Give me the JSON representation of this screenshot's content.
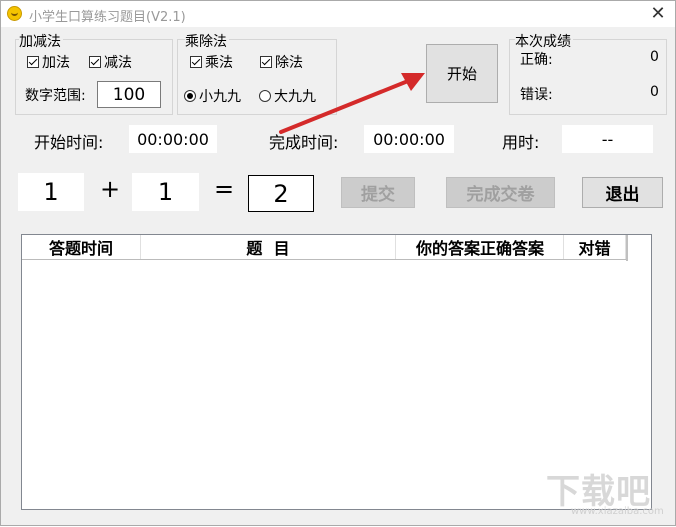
{
  "window": {
    "title": "小学生口算练习题目(V2.1)",
    "close_label": "✕"
  },
  "add_sub": {
    "title": "加减法",
    "add_label": "加法",
    "add_checked": true,
    "sub_label": "减法",
    "sub_checked": true,
    "range_label": "数字范围:",
    "range_value": "100"
  },
  "mul_div": {
    "title": "乘除法",
    "mul_label": "乘法",
    "mul_checked": true,
    "div_label": "除法",
    "div_checked": true,
    "small_label": "小九九",
    "small_selected": true,
    "big_label": "大九九",
    "big_selected": false
  },
  "start_button": {
    "label": "开始"
  },
  "score": {
    "title": "本次成绩",
    "correct_label": "正确:",
    "correct_value": "0",
    "wrong_label": "错误:",
    "wrong_value": "0"
  },
  "times": {
    "start_label": "开始时间:",
    "start_value": "00:00:00",
    "finish_label": "完成时间:",
    "finish_value": "00:00:00",
    "used_label": "用时:",
    "used_value": "--"
  },
  "question": {
    "operand1": "1",
    "operator": "+",
    "operand2": "1",
    "equals": "=",
    "answer": "2"
  },
  "buttons": {
    "submit": "提交",
    "finish": "完成交卷",
    "exit": "退出"
  },
  "table": {
    "columns": [
      "答题时间",
      "题  目",
      "你的答案",
      "正确答案",
      "对错"
    ]
  },
  "watermark": {
    "text": "下载吧",
    "sub": "www.xiazaiba.com"
  },
  "colors": {
    "arrow": "#d42a2a",
    "accent_icon": "#f5c400"
  }
}
